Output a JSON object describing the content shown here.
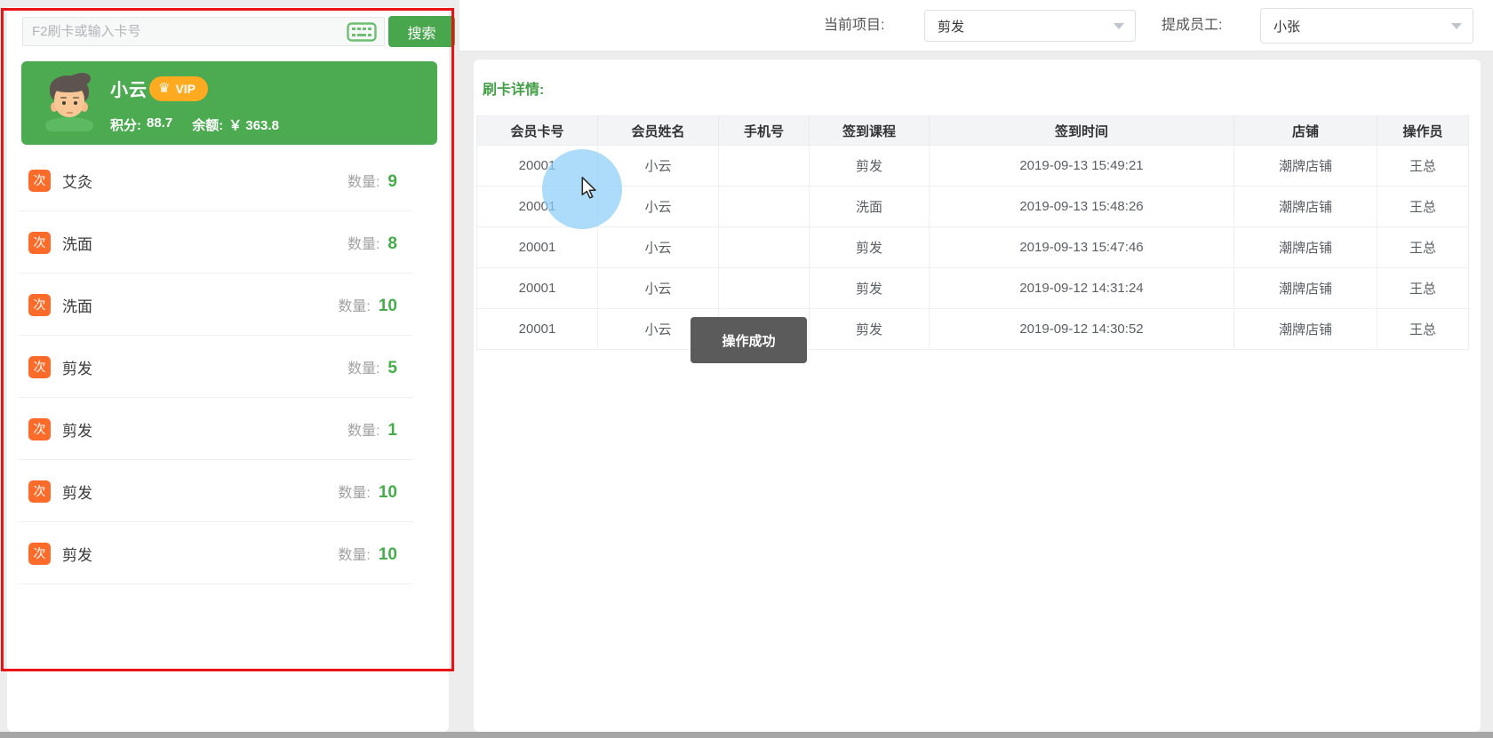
{
  "search": {
    "placeholder": "F2刷卡或输入卡号",
    "button_label": "搜索"
  },
  "member": {
    "name": "小云",
    "vip_label": "VIP",
    "points_label": "积分:",
    "points": "88.7",
    "balance_label": "余额:",
    "balance": "￥ 363.8"
  },
  "card_list": {
    "icon_char": "次",
    "qty_label": "数量:",
    "items": [
      {
        "name": "艾灸",
        "qty": "9"
      },
      {
        "name": "洗面",
        "qty": "8"
      },
      {
        "name": "洗面",
        "qty": "10"
      },
      {
        "name": "剪发",
        "qty": "5"
      },
      {
        "name": "剪发",
        "qty": "1"
      },
      {
        "name": "剪发",
        "qty": "10"
      },
      {
        "name": "剪发",
        "qty": "10"
      }
    ]
  },
  "toolbar": {
    "project_label": "当前项目:",
    "project_value": "剪发",
    "staff_label": "提成员工:",
    "staff_value": "小张"
  },
  "details": {
    "title": "刷卡详情:"
  },
  "table": {
    "headers": [
      "会员卡号",
      "会员姓名",
      "手机号",
      "签到课程",
      "签到时间",
      "店铺",
      "操作员"
    ],
    "rows": [
      [
        "20001",
        "小云",
        "",
        "剪发",
        "2019-09-13 15:49:21",
        "潮牌店铺",
        "王总"
      ],
      [
        "20001",
        "小云",
        "",
        "洗面",
        "2019-09-13 15:48:26",
        "潮牌店铺",
        "王总"
      ],
      [
        "20001",
        "小云",
        "",
        "剪发",
        "2019-09-13 15:47:46",
        "潮牌店铺",
        "王总"
      ],
      [
        "20001",
        "小云",
        "",
        "剪发",
        "2019-09-12 14:31:24",
        "潮牌店铺",
        "王总"
      ],
      [
        "20001",
        "小云",
        "",
        "剪发",
        "2019-09-12 14:30:52",
        "潮牌店铺",
        "王总"
      ]
    ]
  },
  "toast": {
    "message": "操作成功"
  },
  "colors": {
    "accent_green": "#4cab51",
    "item_icon_orange": "#fd6b2a",
    "vip_orange": "#ffaa1f",
    "outline_red": "#e81313",
    "toast_gray": "#5b5b5b",
    "click_highlight_blue": "#8ccef7"
  }
}
